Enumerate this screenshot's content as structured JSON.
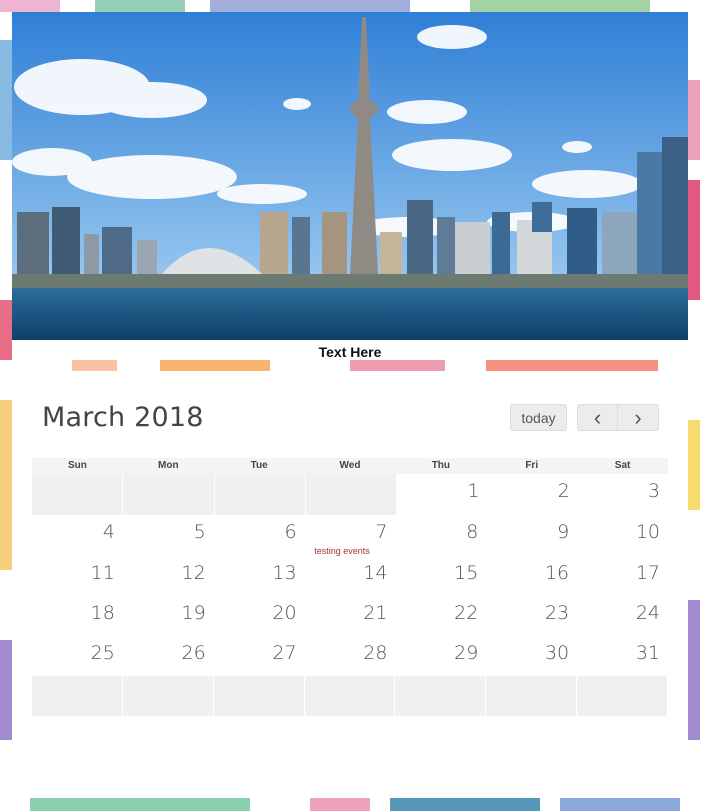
{
  "photo": {
    "caption": "Text Here"
  },
  "calendar": {
    "title": "March 2018",
    "buttons": {
      "today": "today",
      "prev": "‹",
      "next": "›"
    },
    "weekdays": [
      "Sun",
      "Mon",
      "Tue",
      "Wed",
      "Thu",
      "Fri",
      "Sat"
    ],
    "weeks": [
      [
        {
          "n": "",
          "other": true
        },
        {
          "n": "",
          "other": true
        },
        {
          "n": "",
          "other": true
        },
        {
          "n": "",
          "other": true
        },
        {
          "n": "1"
        },
        {
          "n": "2"
        },
        {
          "n": "3"
        }
      ],
      [
        {
          "n": "4"
        },
        {
          "n": "5"
        },
        {
          "n": "6"
        },
        {
          "n": "7",
          "event": "testing events"
        },
        {
          "n": "8"
        },
        {
          "n": "9"
        },
        {
          "n": "10"
        }
      ],
      [
        {
          "n": "11"
        },
        {
          "n": "12"
        },
        {
          "n": "13"
        },
        {
          "n": "14"
        },
        {
          "n": "15"
        },
        {
          "n": "16"
        },
        {
          "n": "17"
        }
      ],
      [
        {
          "n": "18"
        },
        {
          "n": "19"
        },
        {
          "n": "20"
        },
        {
          "n": "21"
        },
        {
          "n": "22"
        },
        {
          "n": "23"
        },
        {
          "n": "24"
        }
      ],
      [
        {
          "n": "25"
        },
        {
          "n": "26"
        },
        {
          "n": "27"
        },
        {
          "n": "28"
        },
        {
          "n": "29"
        },
        {
          "n": "30"
        },
        {
          "n": "31"
        }
      ],
      [
        {
          "n": "",
          "other": true
        },
        {
          "n": "",
          "other": true
        },
        {
          "n": "",
          "other": true
        },
        {
          "n": "",
          "other": true
        },
        {
          "n": "",
          "other": true
        },
        {
          "n": "",
          "other": true
        },
        {
          "n": "",
          "other": true
        }
      ]
    ],
    "event_color": "#a83232"
  }
}
